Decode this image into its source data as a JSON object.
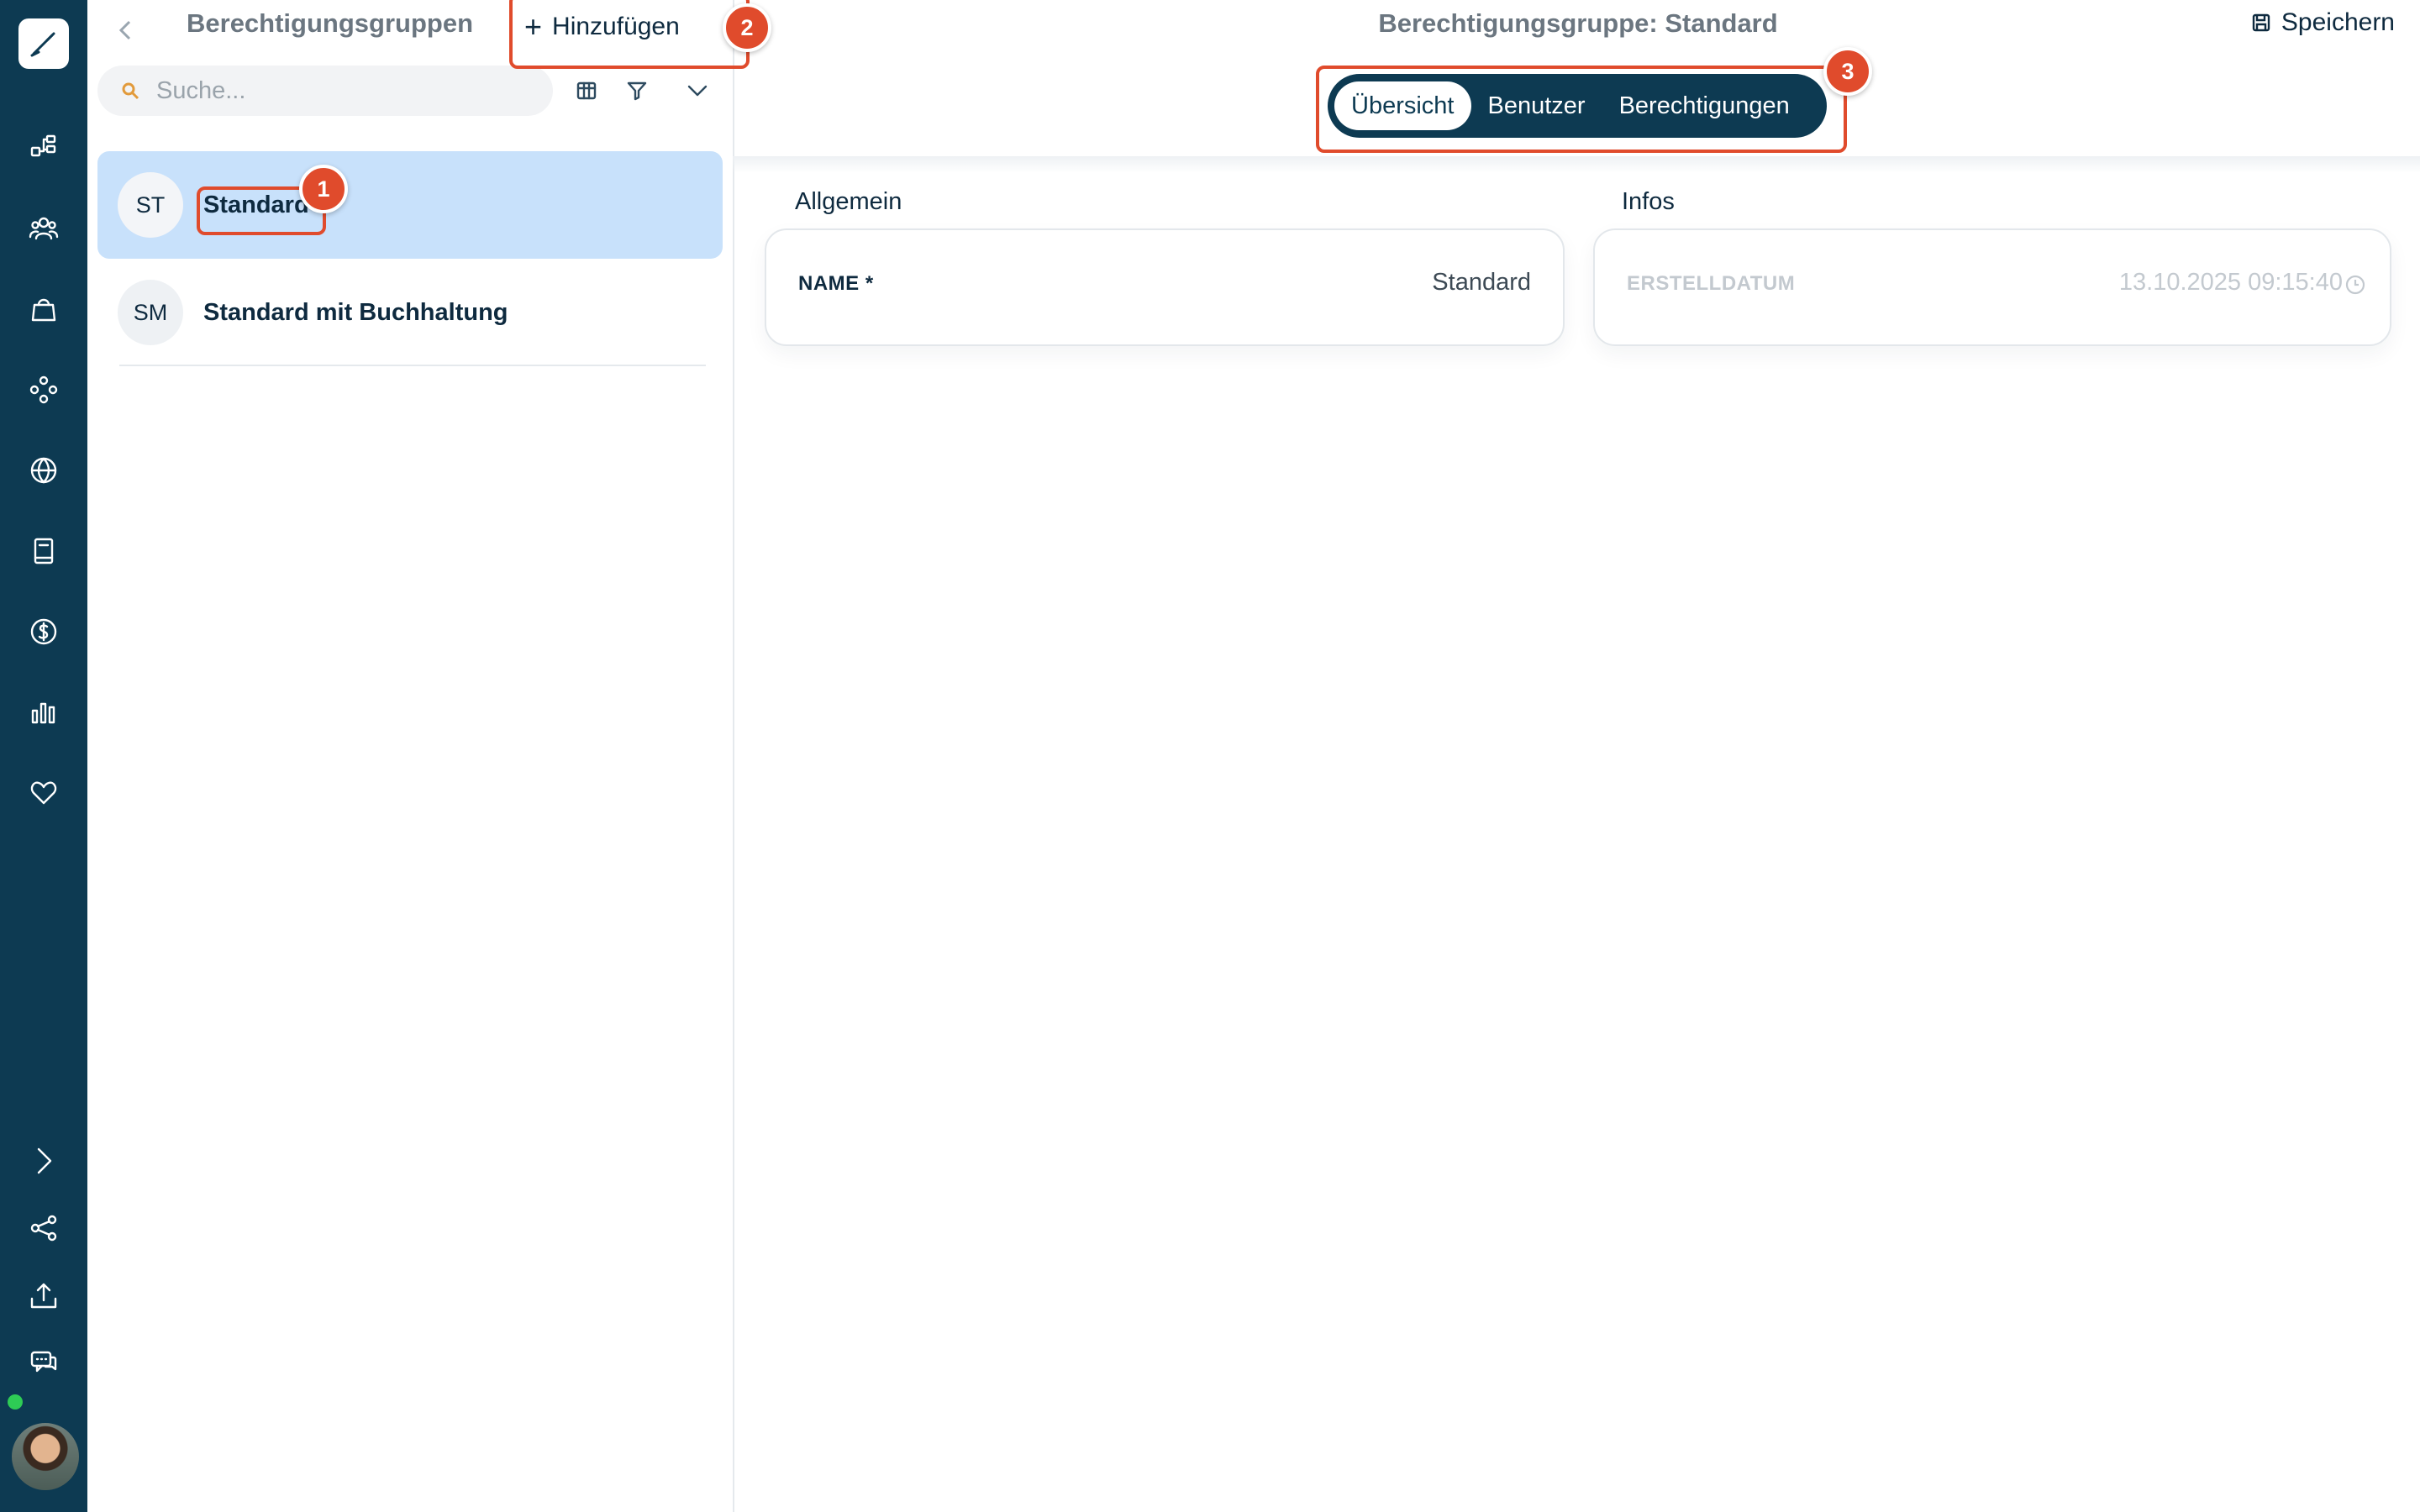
{
  "list_panel": {
    "title": "Berechtigungsgruppen",
    "add_label": "Hinzufügen",
    "search_placeholder": "Suche...",
    "groups": [
      {
        "initials": "ST",
        "name": "Standard",
        "selected": true
      },
      {
        "initials": "SM",
        "name": "Standard mit Buchhaltung",
        "selected": false
      }
    ]
  },
  "detail": {
    "title": "Berechtigungsgruppe: Standard",
    "save_label": "Speichern",
    "tabs": [
      {
        "label": "Übersicht",
        "active": true
      },
      {
        "label": "Benutzer",
        "active": false
      },
      {
        "label": "Berechtigungen",
        "active": false
      }
    ],
    "general": {
      "section": "Allgemein",
      "name_label": "NAME *",
      "name_value": "Standard"
    },
    "infos": {
      "section": "Infos",
      "created_label": "ERSTELLDATUM",
      "created_value": "13.10.2025 09:15:40"
    }
  },
  "callouts": [
    "1",
    "2",
    "3"
  ],
  "colors": {
    "rail": "#0d3a52",
    "selected_row": "#c8e1fb",
    "callout": "#e04b2c",
    "online": "#2ecc55"
  },
  "icons": {
    "rail": [
      "app-logo-icon",
      "workflow-icon",
      "users-icon",
      "shopping-bag-icon",
      "modules-icon",
      "globe-icon",
      "book-icon",
      "dollar-icon",
      "bar-chart-icon",
      "heart-icon",
      "expand-icon",
      "share-icon",
      "upload-icon",
      "chat-icon"
    ],
    "toolbar": [
      "table-icon",
      "filter-icon",
      "chevron-down-icon"
    ]
  }
}
